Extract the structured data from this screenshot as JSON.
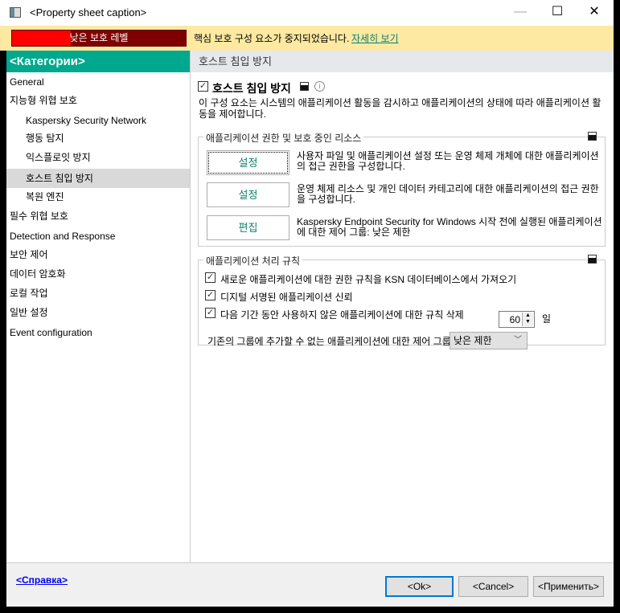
{
  "window": {
    "title": "<Property sheet caption>",
    "minimize": "—",
    "maximize": "☐",
    "close": "✕"
  },
  "banner": {
    "level_label": "낮은 보호 레벨",
    "level_fraction": 0.34,
    "message": "핵심 보호 구성 요소가 중지되었습니다.",
    "link": "자세히 보기"
  },
  "sidebar": {
    "header": "<Категории>",
    "items": [
      {
        "label": "General"
      },
      {
        "label": "지능형 위협 보호"
      },
      {
        "label": "Kaspersky Security Network"
      },
      {
        "label": "행동 탐지"
      },
      {
        "label": "익스플로잇 방지"
      },
      {
        "label": "호스트 침입 방지"
      },
      {
        "label": "복원 엔진"
      },
      {
        "label": "필수 위협 보호"
      },
      {
        "label": "Detection and Response"
      },
      {
        "label": "보안 제어"
      },
      {
        "label": "데이터 암호화"
      },
      {
        "label": "로컬 작업"
      },
      {
        "label": "일반 설정"
      },
      {
        "label": "Event configuration"
      }
    ]
  },
  "main": {
    "header": "호스트 침입 방지",
    "component_title": "호스트 침입 방지",
    "component_enabled": true,
    "info": "i",
    "description": "이 구성 요소는 시스템의 애플리케이션 활동을 감시하고 애플리케이션의 상태에 따라 애플리케이션 활동을 제어합니다.",
    "group1": {
      "label": "애플리케이션 권한 및 보호 중인 리소스",
      "rows": [
        {
          "button": "설정",
          "text": "사용자 파일 및 애플리케이션 설정 또는 운영 체제 개체에 대한 애플리케이션의 접근 권한을 구성합니다."
        },
        {
          "button": "설정",
          "text": "운영 체제 리소스 및 개인 데이터 카테고리에 대한 애플리케이션의 접근 권한을 구성합니다."
        },
        {
          "button": "편집",
          "text": "Kaspersky Endpoint Security for Windows 시작 전에 실행된 애플리케이션에 대한 제어 그룹: 낮은 제한"
        }
      ]
    },
    "group2": {
      "label": "애플리케이션 처리 규칙",
      "check1": "새로운 애플리케이션에 대한 권한 규칙을 KSN 데이터베이스에서 가져오기",
      "check2": "디지털 서명된 애플리케이션 신뢰",
      "check3": "다음 기간 동안 사용하지 않은 애플리케이션에 대한 규칙 삭제",
      "days_value": "60",
      "days_unit": "일",
      "group_label": "기존의 그룹에 추가할 수 없는 애플리케이션에 대한 제어 그룹",
      "group_value": "낮은 제한"
    }
  },
  "footer": {
    "help": "<Справка>",
    "ok": "<Ok>",
    "cancel": "<Cancel>",
    "apply": "<Применить>"
  }
}
